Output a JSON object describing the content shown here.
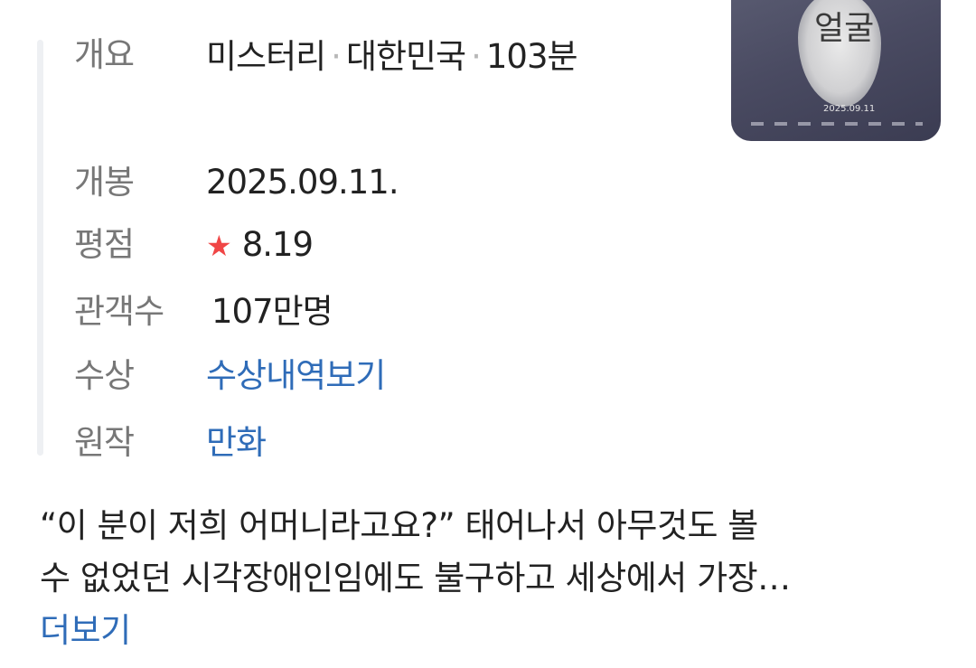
{
  "info": {
    "genre": {
      "label": "개요",
      "value_parts": [
        "미스터리",
        "대한민국",
        "103분"
      ],
      "separator": "·"
    },
    "release": {
      "label": "개봉",
      "value": "2025.09.11."
    },
    "rating": {
      "label": "평점",
      "star": "★",
      "value": "8.19"
    },
    "audience": {
      "label": "관객수",
      "value": "107만명"
    },
    "award": {
      "label": "수상",
      "link": "수상내역보기"
    },
    "original": {
      "label": "원작",
      "link": "만화"
    }
  },
  "poster": {
    "title": "얼굴",
    "date": "2025.09.11"
  },
  "synopsis": {
    "line1": "“이 분이 저희 어머니라고요?” 태어나서 아무것도 볼",
    "line2": "수 없었던 시각장애인임에도 불구하고 세상에서 가장…",
    "more": "더보기"
  },
  "colors": {
    "label": "#777777",
    "value": "#222222",
    "link": "#2f6cb8",
    "star": "#f04646"
  }
}
